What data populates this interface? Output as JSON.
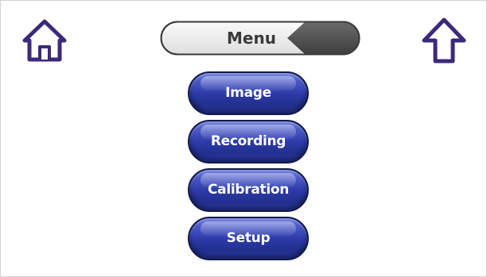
{
  "header": {
    "title": "Menu",
    "home_icon": "home-icon",
    "up_icon": "arrow-up-icon"
  },
  "menu": {
    "items": [
      {
        "label": "Image"
      },
      {
        "label": "Recording"
      },
      {
        "label": "Calibration"
      },
      {
        "label": "Setup"
      }
    ]
  },
  "colors": {
    "button_blue": "#2d3aa8",
    "icon_purple": "#3b2a7a",
    "bar_dark": "#555555",
    "bar_light": "#f2f2f2"
  }
}
